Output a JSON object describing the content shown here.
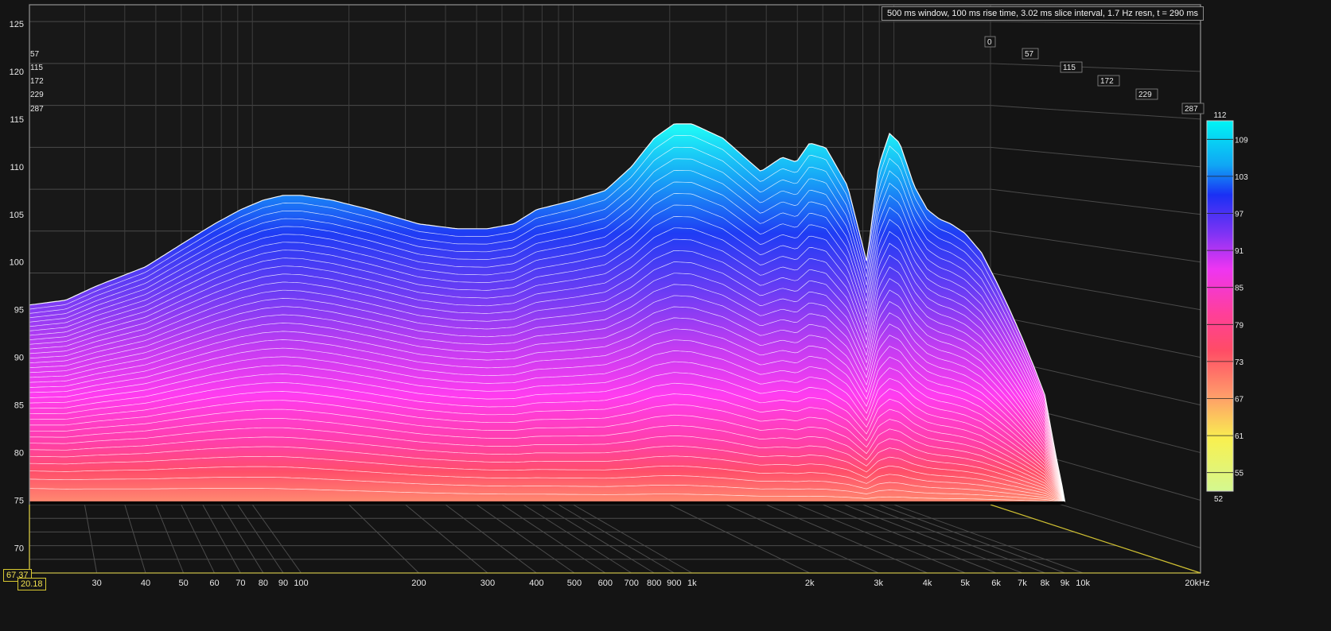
{
  "chart_data": {
    "type": "waterfall",
    "info": "500 ms window, 100 ms rise time, 3.02 ms slice interval, 1.7 Hz resn, t = 290 ms",
    "x_ticks": [
      "30",
      "40",
      "50",
      "60",
      "70",
      "80",
      "90",
      "100",
      "200",
      "300",
      "400",
      "500",
      "600",
      "700",
      "800",
      "900",
      "1k",
      "2k",
      "3k",
      "4k",
      "5k",
      "6k",
      "7k",
      "8k",
      "9k",
      "10k",
      "20kHz"
    ],
    "x_tick_values": [
      30,
      40,
      50,
      60,
      70,
      80,
      90,
      100,
      200,
      300,
      400,
      500,
      600,
      700,
      800,
      900,
      1000,
      2000,
      3000,
      4000,
      5000,
      6000,
      7000,
      8000,
      9000,
      10000,
      20000
    ],
    "xlim": [
      20.18,
      20000
    ],
    "y_ticks": [
      "70",
      "75",
      "80",
      "85",
      "90",
      "95",
      "100",
      "105",
      "110",
      "115",
      "120",
      "125"
    ],
    "y_tick_values": [
      70,
      75,
      80,
      85,
      90,
      95,
      100,
      105,
      110,
      115,
      120,
      125
    ],
    "ylim": [
      67.37,
      127
    ],
    "time_ticks": [
      "0",
      "57",
      "115",
      "172",
      "229",
      "287"
    ],
    "cursor_x": "20.18",
    "cursor_y": "67.37",
    "colorbar": {
      "max_label": "112",
      "min_label": "52",
      "ticks": [
        "109",
        "103",
        "97",
        "91",
        "85",
        "79",
        "73",
        "67",
        "61",
        "55"
      ]
    },
    "first_slice": {
      "freq_hz": [
        20.18,
        25,
        30,
        40,
        50,
        60,
        70,
        80,
        90,
        100,
        120,
        150,
        200,
        250,
        300,
        350,
        400,
        500,
        600,
        700,
        800,
        900,
        1000,
        1200,
        1500,
        1700,
        1850,
        2000,
        2200,
        2500,
        2800,
        3000,
        3200,
        3400,
        3700,
        4000,
        4300,
        4600,
        5000,
        5500,
        6000,
        6500,
        7000,
        7500,
        8000,
        8500,
        9000
      ],
      "spl_db": [
        95.5,
        96,
        97.5,
        99.5,
        102,
        104,
        105.5,
        106.5,
        107,
        107,
        106.5,
        105.5,
        104,
        103.5,
        103.5,
        104,
        105.5,
        106.5,
        107.5,
        110,
        113,
        114.5,
        114.5,
        113,
        109.5,
        111,
        110.5,
        112.5,
        112,
        108,
        100,
        110,
        113.5,
        112.5,
        108,
        105.5,
        104.5,
        104,
        103,
        101,
        98,
        95,
        92,
        89,
        86,
        80,
        75
      ]
    }
  }
}
